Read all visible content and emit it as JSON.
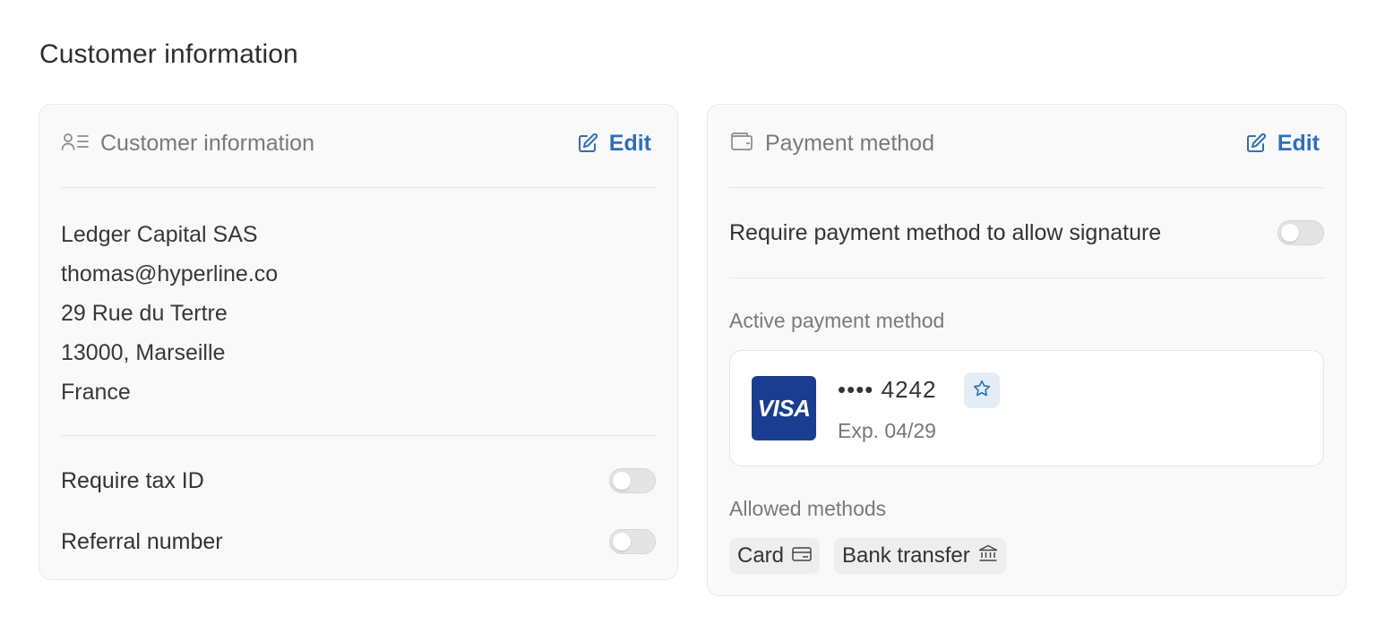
{
  "page": {
    "title": "Customer information"
  },
  "customer_card": {
    "title": "Customer information",
    "edit_label": "Edit",
    "company": "Ledger Capital SAS",
    "email": "thomas@hyperline.co",
    "street": "29 Rue du Tertre",
    "city_line": "13000, Marseille",
    "country": "France",
    "toggles": [
      {
        "label": "Require tax ID",
        "on": false
      },
      {
        "label": "Referral number",
        "on": false
      }
    ]
  },
  "payment_card": {
    "title": "Payment method",
    "edit_label": "Edit",
    "require_toggle": {
      "label": "Require payment method to allow signature",
      "on": false
    },
    "active_label": "Active payment method",
    "active_method": {
      "brand": "VISA",
      "number": "•••• 4242",
      "expiry": "Exp. 04/29",
      "default_icon": "star-icon"
    },
    "allowed_label": "Allowed methods",
    "allowed_methods": [
      {
        "label": "Card",
        "icon": "credit-card-icon"
      },
      {
        "label": "Bank transfer",
        "icon": "bank-icon"
      }
    ]
  },
  "colors": {
    "accent": "#2f6fb8",
    "visa_blue": "#1a3d8f",
    "card_bg": "#f9f9f9"
  }
}
